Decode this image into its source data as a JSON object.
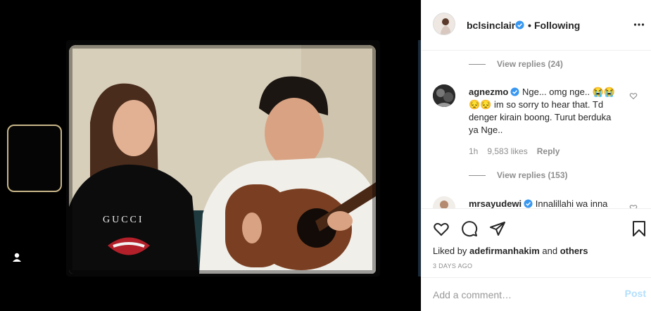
{
  "header": {
    "username": "bclsinclair",
    "separator": "•",
    "follow_status": "Following"
  },
  "comments": {
    "view_replies_1": "View replies (24)",
    "comment_1": {
      "username": "agnezmo",
      "text": "Nge... omg nge.. 😭😭😔😔 im so sorry to hear that. Td denger kirain boong. Turut berduka ya Nge..",
      "time": "1h",
      "likes": "9,583 likes",
      "reply": "Reply"
    },
    "view_replies_2": "View replies (153)",
    "comment_2": {
      "username": "mrsayudewi",
      "text": "Innalillahi wa inna"
    }
  },
  "post": {
    "liked_by_prefix": "Liked by",
    "liked_by_user": "adefirmanhakim",
    "liked_by_and": "and",
    "liked_by_others": "others",
    "time_ago": "3 DAYS AGO"
  },
  "add_comment": {
    "placeholder": "Add a comment…",
    "post_label": "Post"
  },
  "video": {
    "shirt_text": "GUCCI"
  },
  "colors": {
    "verified_blue": "#3897f0",
    "post_disabled": "#b2dffc",
    "secondary_text": "#8e8e8e"
  }
}
